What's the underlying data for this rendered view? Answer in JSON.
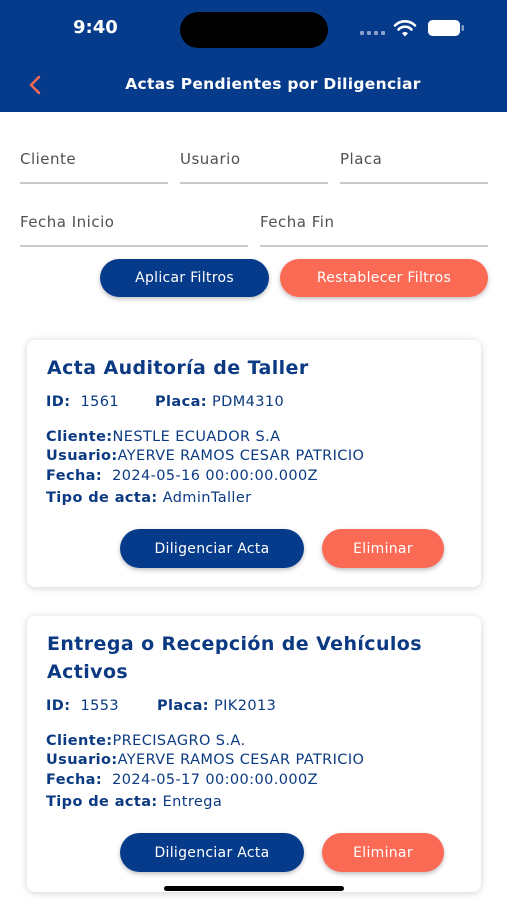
{
  "status_bar": {
    "time": "9:40"
  },
  "header": {
    "title": "Actas Pendientes por Diligenciar"
  },
  "filters": {
    "cliente_placeholder": "Cliente",
    "usuario_placeholder": "Usuario",
    "placa_placeholder": "Placa",
    "fecha_inicio_placeholder": "Fecha Inicio",
    "fecha_fin_placeholder": "Fecha Fin",
    "apply_label": "Aplicar Filtros",
    "reset_label": "Restablecer Filtros"
  },
  "labels": {
    "id": "ID:",
    "placa": "Placa:",
    "cliente": "Cliente:",
    "usuario": "Usuario:",
    "fecha": "Fecha:",
    "tipo": "Tipo de acta:"
  },
  "cards": [
    {
      "title": "Acta Auditoría de Taller",
      "id": "1561",
      "placa": "PDM4310",
      "cliente": "NESTLE ECUADOR S.A",
      "usuario": "AYERVE RAMOS CESAR PATRICIO",
      "fecha": "2024-05-16 00:00:00.000Z",
      "tipo": "AdminTaller",
      "diligenciar_label": "Diligenciar Acta",
      "eliminar_label": "Eliminar"
    },
    {
      "title": "Entrega o Recepción de Vehículos Activos",
      "id": "1553",
      "placa": "PIK2013",
      "cliente": "PRECISAGRO S.A.",
      "usuario": "AYERVE RAMOS CESAR PATRICIO",
      "fecha": "2024-05-17 00:00:00.000Z",
      "tipo": "Entrega",
      "diligenciar_label": "Diligenciar Acta",
      "eliminar_label": "Eliminar"
    }
  ],
  "colors": {
    "primary": "#053b8a",
    "accent": "#fb6a55",
    "text": "#0b3a82"
  },
  "icons": {
    "back": "chevron-left-icon",
    "wifi": "wifi-icon",
    "battery": "battery-icon",
    "signal": "signal-icon"
  }
}
